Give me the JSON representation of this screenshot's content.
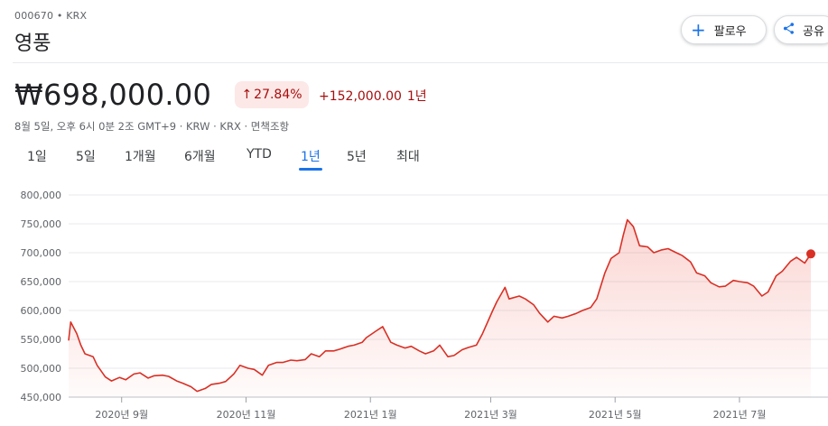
{
  "header": {
    "ticker": "000670 • KRX",
    "name": "영풍",
    "follow_label": "팔로우",
    "share_label": "공유"
  },
  "quote": {
    "price": "₩698,000.00",
    "change_pct": "27.84%",
    "change_abs": "+152,000.00",
    "period": "1년",
    "meta": "8월 5일, 오후 6시 0분 2조 GMT+9 · KRW · KRX · 면책조항"
  },
  "tabs": [
    {
      "label": "1일"
    },
    {
      "label": "5일"
    },
    {
      "label": "1개월"
    },
    {
      "label": "6개월"
    },
    {
      "label": "YTD"
    },
    {
      "label": "1년",
      "active": true
    },
    {
      "label": "5년"
    },
    {
      "label": "최대"
    }
  ],
  "colors": {
    "accent": "#1a73e8",
    "negative_text": "#a50e0e",
    "line": "#d93025"
  },
  "chart_data": {
    "type": "area",
    "ylim": [
      450000,
      800000
    ],
    "yticks": [
      "800,000",
      "750,000",
      "700,000",
      "650,000",
      "600,000",
      "550,000",
      "500,000",
      "450,000"
    ],
    "ytick_values": [
      800000,
      750000,
      700000,
      650000,
      600000,
      550000,
      500000,
      450000
    ],
    "xticks": [
      {
        "label": "2020년 9월",
        "date": "2020-09-01"
      },
      {
        "label": "2020년 11월",
        "date": "2020-11-01"
      },
      {
        "label": "2021년 1월",
        "date": "2021-01-01"
      },
      {
        "label": "2021년 3월",
        "date": "2021-03-01"
      },
      {
        "label": "2021년 5월",
        "date": "2021-05-01"
      },
      {
        "label": "2021년 7월",
        "date": "2021-07-01"
      }
    ],
    "x_range": [
      "2020-08-06",
      "2021-08-05"
    ],
    "series": [
      {
        "points": [
          [
            "2020-08-06",
            548000
          ],
          [
            "2020-08-07",
            580000
          ],
          [
            "2020-08-10",
            560000
          ],
          [
            "2020-08-12",
            540000
          ],
          [
            "2020-08-14",
            525000
          ],
          [
            "2020-08-18",
            520000
          ],
          [
            "2020-08-20",
            505000
          ],
          [
            "2020-08-24",
            485000
          ],
          [
            "2020-08-27",
            478000
          ],
          [
            "2020-08-31",
            484000
          ],
          [
            "2020-09-03",
            480000
          ],
          [
            "2020-09-07",
            490000
          ],
          [
            "2020-09-10",
            492000
          ],
          [
            "2020-09-14",
            483000
          ],
          [
            "2020-09-17",
            487000
          ],
          [
            "2020-09-21",
            488000
          ],
          [
            "2020-09-24",
            486000
          ],
          [
            "2020-09-28",
            478000
          ],
          [
            "2020-10-01",
            474000
          ],
          [
            "2020-10-05",
            468000
          ],
          [
            "2020-10-08",
            460000
          ],
          [
            "2020-10-12",
            465000
          ],
          [
            "2020-10-15",
            472000
          ],
          [
            "2020-10-19",
            474000
          ],
          [
            "2020-10-22",
            477000
          ],
          [
            "2020-10-26",
            490000
          ],
          [
            "2020-10-29",
            505000
          ],
          [
            "2020-11-02",
            500000
          ],
          [
            "2020-11-05",
            498000
          ],
          [
            "2020-11-09",
            488000
          ],
          [
            "2020-11-12",
            505000
          ],
          [
            "2020-11-16",
            510000
          ],
          [
            "2020-11-19",
            510000
          ],
          [
            "2020-11-23",
            514000
          ],
          [
            "2020-11-26",
            513000
          ],
          [
            "2020-11-30",
            515000
          ],
          [
            "2020-12-03",
            525000
          ],
          [
            "2020-12-07",
            520000
          ],
          [
            "2020-12-10",
            530000
          ],
          [
            "2020-12-14",
            530000
          ],
          [
            "2020-12-17",
            533000
          ],
          [
            "2020-12-21",
            538000
          ],
          [
            "2020-12-24",
            540000
          ],
          [
            "2020-12-28",
            545000
          ],
          [
            "2020-12-30",
            553000
          ],
          [
            "2021-01-04",
            565000
          ],
          [
            "2021-01-07",
            572000
          ],
          [
            "2021-01-11",
            545000
          ],
          [
            "2021-01-14",
            540000
          ],
          [
            "2021-01-18",
            535000
          ],
          [
            "2021-01-21",
            538000
          ],
          [
            "2021-01-25",
            530000
          ],
          [
            "2021-01-28",
            525000
          ],
          [
            "2021-02-01",
            530000
          ],
          [
            "2021-02-04",
            540000
          ],
          [
            "2021-02-08",
            520000
          ],
          [
            "2021-02-11",
            522000
          ],
          [
            "2021-02-15",
            532000
          ],
          [
            "2021-02-18",
            536000
          ],
          [
            "2021-02-22",
            540000
          ],
          [
            "2021-02-25",
            560000
          ],
          [
            "2021-03-02",
            600000
          ],
          [
            "2021-03-04",
            615000
          ],
          [
            "2021-03-08",
            640000
          ],
          [
            "2021-03-10",
            620000
          ],
          [
            "2021-03-15",
            625000
          ],
          [
            "2021-03-18",
            620000
          ],
          [
            "2021-03-22",
            610000
          ],
          [
            "2021-03-25",
            595000
          ],
          [
            "2021-03-29",
            580000
          ],
          [
            "2021-04-01",
            590000
          ],
          [
            "2021-04-05",
            587000
          ],
          [
            "2021-04-08",
            590000
          ],
          [
            "2021-04-12",
            595000
          ],
          [
            "2021-04-15",
            600000
          ],
          [
            "2021-04-19",
            605000
          ],
          [
            "2021-04-22",
            620000
          ],
          [
            "2021-04-26",
            665000
          ],
          [
            "2021-04-29",
            690000
          ],
          [
            "2021-05-03",
            700000
          ],
          [
            "2021-05-05",
            730000
          ],
          [
            "2021-05-07",
            757000
          ],
          [
            "2021-05-10",
            745000
          ],
          [
            "2021-05-13",
            712000
          ],
          [
            "2021-05-17",
            710000
          ],
          [
            "2021-05-20",
            700000
          ],
          [
            "2021-05-24",
            705000
          ],
          [
            "2021-05-27",
            707000
          ],
          [
            "2021-05-31",
            700000
          ],
          [
            "2021-06-03",
            695000
          ],
          [
            "2021-06-07",
            684000
          ],
          [
            "2021-06-10",
            665000
          ],
          [
            "2021-06-14",
            660000
          ],
          [
            "2021-06-17",
            648000
          ],
          [
            "2021-06-21",
            641000
          ],
          [
            "2021-06-24",
            642000
          ],
          [
            "2021-06-28",
            652000
          ],
          [
            "2021-07-01",
            650000
          ],
          [
            "2021-07-05",
            648000
          ],
          [
            "2021-07-08",
            642000
          ],
          [
            "2021-07-12",
            625000
          ],
          [
            "2021-07-15",
            632000
          ],
          [
            "2021-07-19",
            660000
          ],
          [
            "2021-07-22",
            668000
          ],
          [
            "2021-07-26",
            685000
          ],
          [
            "2021-07-29",
            692000
          ],
          [
            "2021-08-02",
            682000
          ],
          [
            "2021-08-05",
            698000
          ]
        ]
      }
    ]
  }
}
